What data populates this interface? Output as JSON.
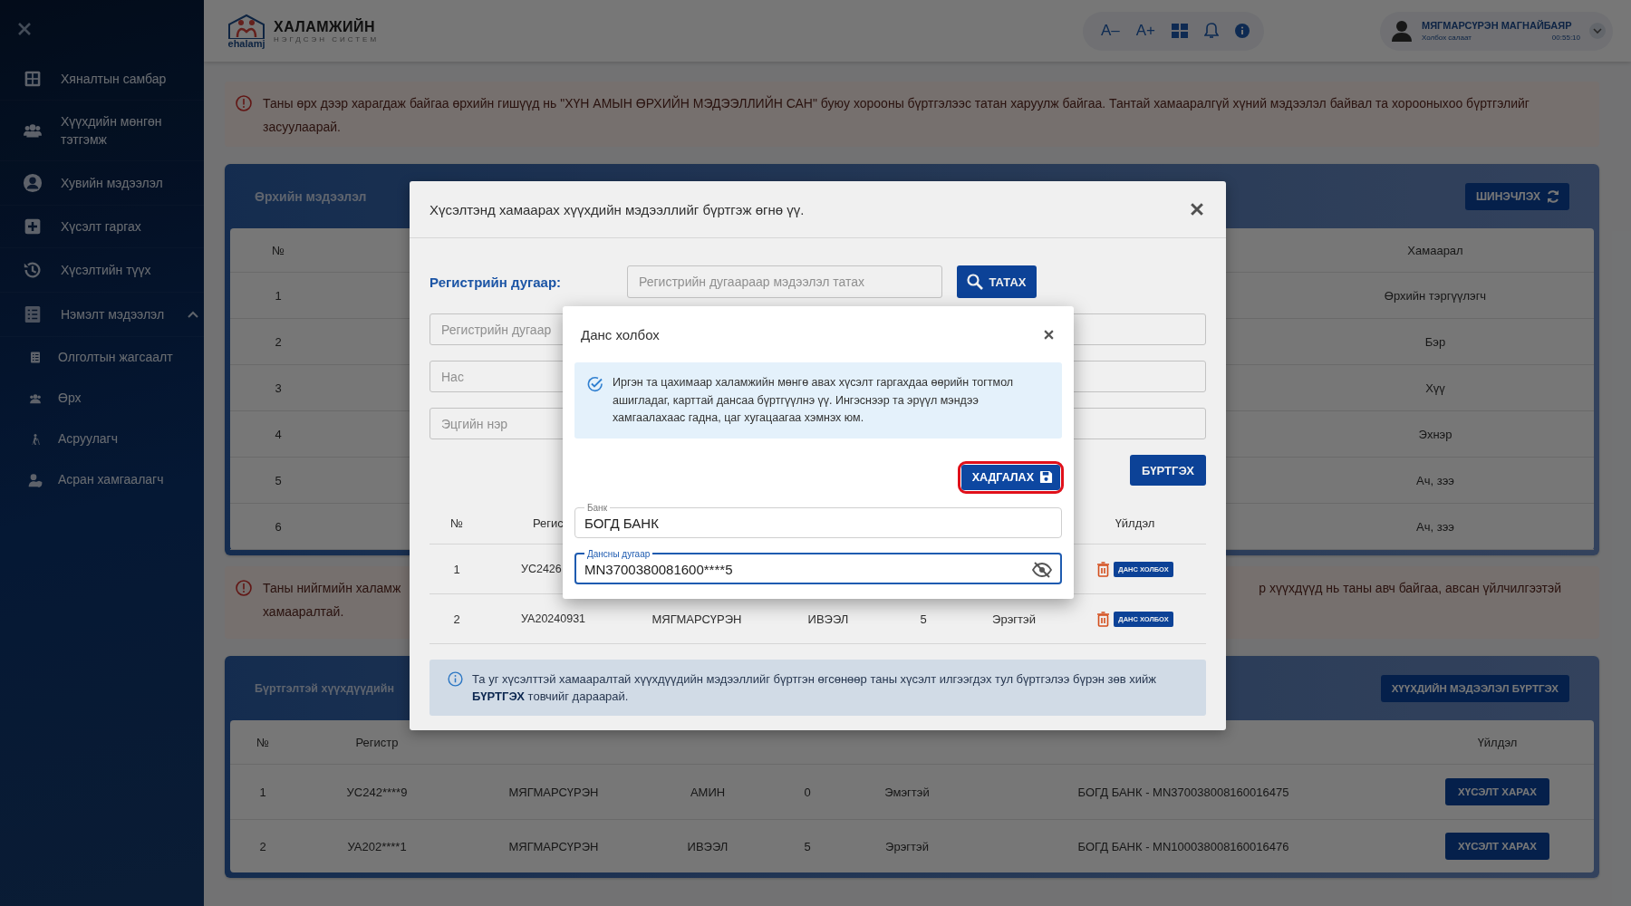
{
  "sidebar": {
    "items": [
      {
        "label": "Хяналтын самбар"
      },
      {
        "label": "Хүүхдийн мөнгөн тэтгэмж"
      },
      {
        "label": "Хувийн мэдээлэл"
      },
      {
        "label": "Хүсэлт гаргах"
      },
      {
        "label": "Хүсэлтийн түүх"
      },
      {
        "label": "Нэмэлт мэдээлэл",
        "expanded": true,
        "children": [
          {
            "label": "Олголтын жагсаалт"
          },
          {
            "label": "Өрх"
          },
          {
            "label": "Асруулагч"
          },
          {
            "label": "Асран хамгаалагч"
          }
        ]
      }
    ]
  },
  "header": {
    "logo": {
      "title": "ХАЛАМЖИЙН",
      "subtitle": "НЭГДСЭН СИСТЕМ",
      "brand": "ehalamj"
    },
    "tools": [
      "A–",
      "A+"
    ],
    "user": {
      "name": "МЯГМАРСҮРЭН МАГНАЙБАЯР",
      "branch": "Холбох салаат",
      "timer": "00:55:10"
    }
  },
  "notice": "Таны өрх дээр харагдаж байгаа өрхийн гишүүд нь \"ХҮН АМЫН ӨРХИЙН МЭДЭЭЛЛИЙН САН\" буюу хорооны бүртгэлээс татан харуулж байгаа. Тантай хамааралгүй хүний мэдээлэл байвал та хорооныхоо бүртгэлийг засуулаарай.",
  "household_card": {
    "title": "Өрхийн мэдээлэл",
    "refresh_button": "ШИНЭЧЛЭХ",
    "columns": [
      "№",
      "Хамаарал"
    ],
    "rows": [
      {
        "number": "1",
        "relation": "Өрхийн тэргүүлэгч"
      },
      {
        "number": "2",
        "relation": "Бэр"
      },
      {
        "number": "3",
        "relation": "Хүү"
      },
      {
        "number": "4",
        "relation": "Эхнэр"
      },
      {
        "number": "5",
        "relation": "Ач, зээ"
      },
      {
        "number": "6",
        "relation": "Ач, зээ"
      }
    ]
  },
  "warning": {
    "left_lines": [
      "Таны нийгмийн халамж",
      "хамааралтай."
    ],
    "right_text": "р хүүхдүүд нь таны авч байгаа, авсан үйлчилгээтэй"
  },
  "children_card": {
    "title": "Бүртгэлтэй хүүхдүүдийн",
    "register_button": "ХҮҮХДИЙН МЭДЭЭЛЭЛ БҮРТГЭХ",
    "columns": [
      "№",
      "Регистр",
      "Үйлдэл"
    ],
    "rows": [
      {
        "number": "1",
        "register": "УС242****9",
        "surname": "МЯГМАРСҮРЭН",
        "name": "АМИН",
        "age": "0",
        "gender": "Эмэгтэй",
        "account": "БОГД БАНК - MN370038008160016475",
        "action": "ХҮСЭЛТ ХАРАХ"
      },
      {
        "number": "2",
        "register": "УА202****1",
        "surname": "МЯГМАРСҮРЭН",
        "name": "ИВЭЭЛ",
        "age": "5",
        "gender": "Эрэгтэй",
        "account": "БОГД БАНК - MN100038008160016476",
        "action": "ХҮСЭЛТ ХАРАХ"
      }
    ]
  },
  "dialog": {
    "title": "Хүсэлтэнд хамаарах хүүхдийн мэдээллийг бүртгэж өгнө үү.",
    "register_label": "Регистрийн дугаар:",
    "search": {
      "placeholder": "Регистрийн дугаараар мэдээлэл татах"
    },
    "fetch_button": "ТАТАХ",
    "fields": [
      {
        "placeholder": "Регистрийн дугаар"
      },
      {
        "placeholder": "Нас"
      },
      {
        "placeholder": "Эцгийн нэр"
      }
    ],
    "submit_button": "БҮРТГЭХ",
    "table": {
      "columns": [
        "№",
        "Регис",
        "Үйлдэл"
      ],
      "rows": [
        {
          "number": "1",
          "register": "УС2426",
          "action": "ДАНС ХОЛБОХ"
        },
        {
          "number": "2",
          "register": "УА20240931",
          "surname": "МЯГМАРСҮРЭН",
          "name": "ИВЭЭЛ",
          "age": "5",
          "gender": "Эрэгтэй",
          "action": "ДАНС ХОЛБОХ"
        }
      ]
    },
    "info": "Та уг хүсэлттэй хамааралтай хүүхдүүдийн мэдээллийг бүртгэн өгсөнөөр таны хүсэлт илгээгдэх тул бүртгэлээ бүрэн зөв хийж **БҮРТГЭХ** товчийг дараарай."
  },
  "account_dialog": {
    "title": "Данс холбох",
    "notice": "Иргэн та цахимаар халамжийн мөнгө авах хүсэлт гаргахдаа өөрийн тогтмол ашигладаг, карттай дансаа бүртгүүлнэ үү. Ингэснээр та эрүүл мэндээ хамгаалахаас гадна, цаг хугацаагаа хэмнэх юм.",
    "save_button": "ХАДГАЛАХ",
    "save_highlighted": true,
    "bank": {
      "label": "Банк",
      "value": "БОГД БАНК"
    },
    "account": {
      "label": "Дансны дугаар",
      "value": "MN3700380081600****5",
      "focused": true,
      "masked": true
    }
  }
}
